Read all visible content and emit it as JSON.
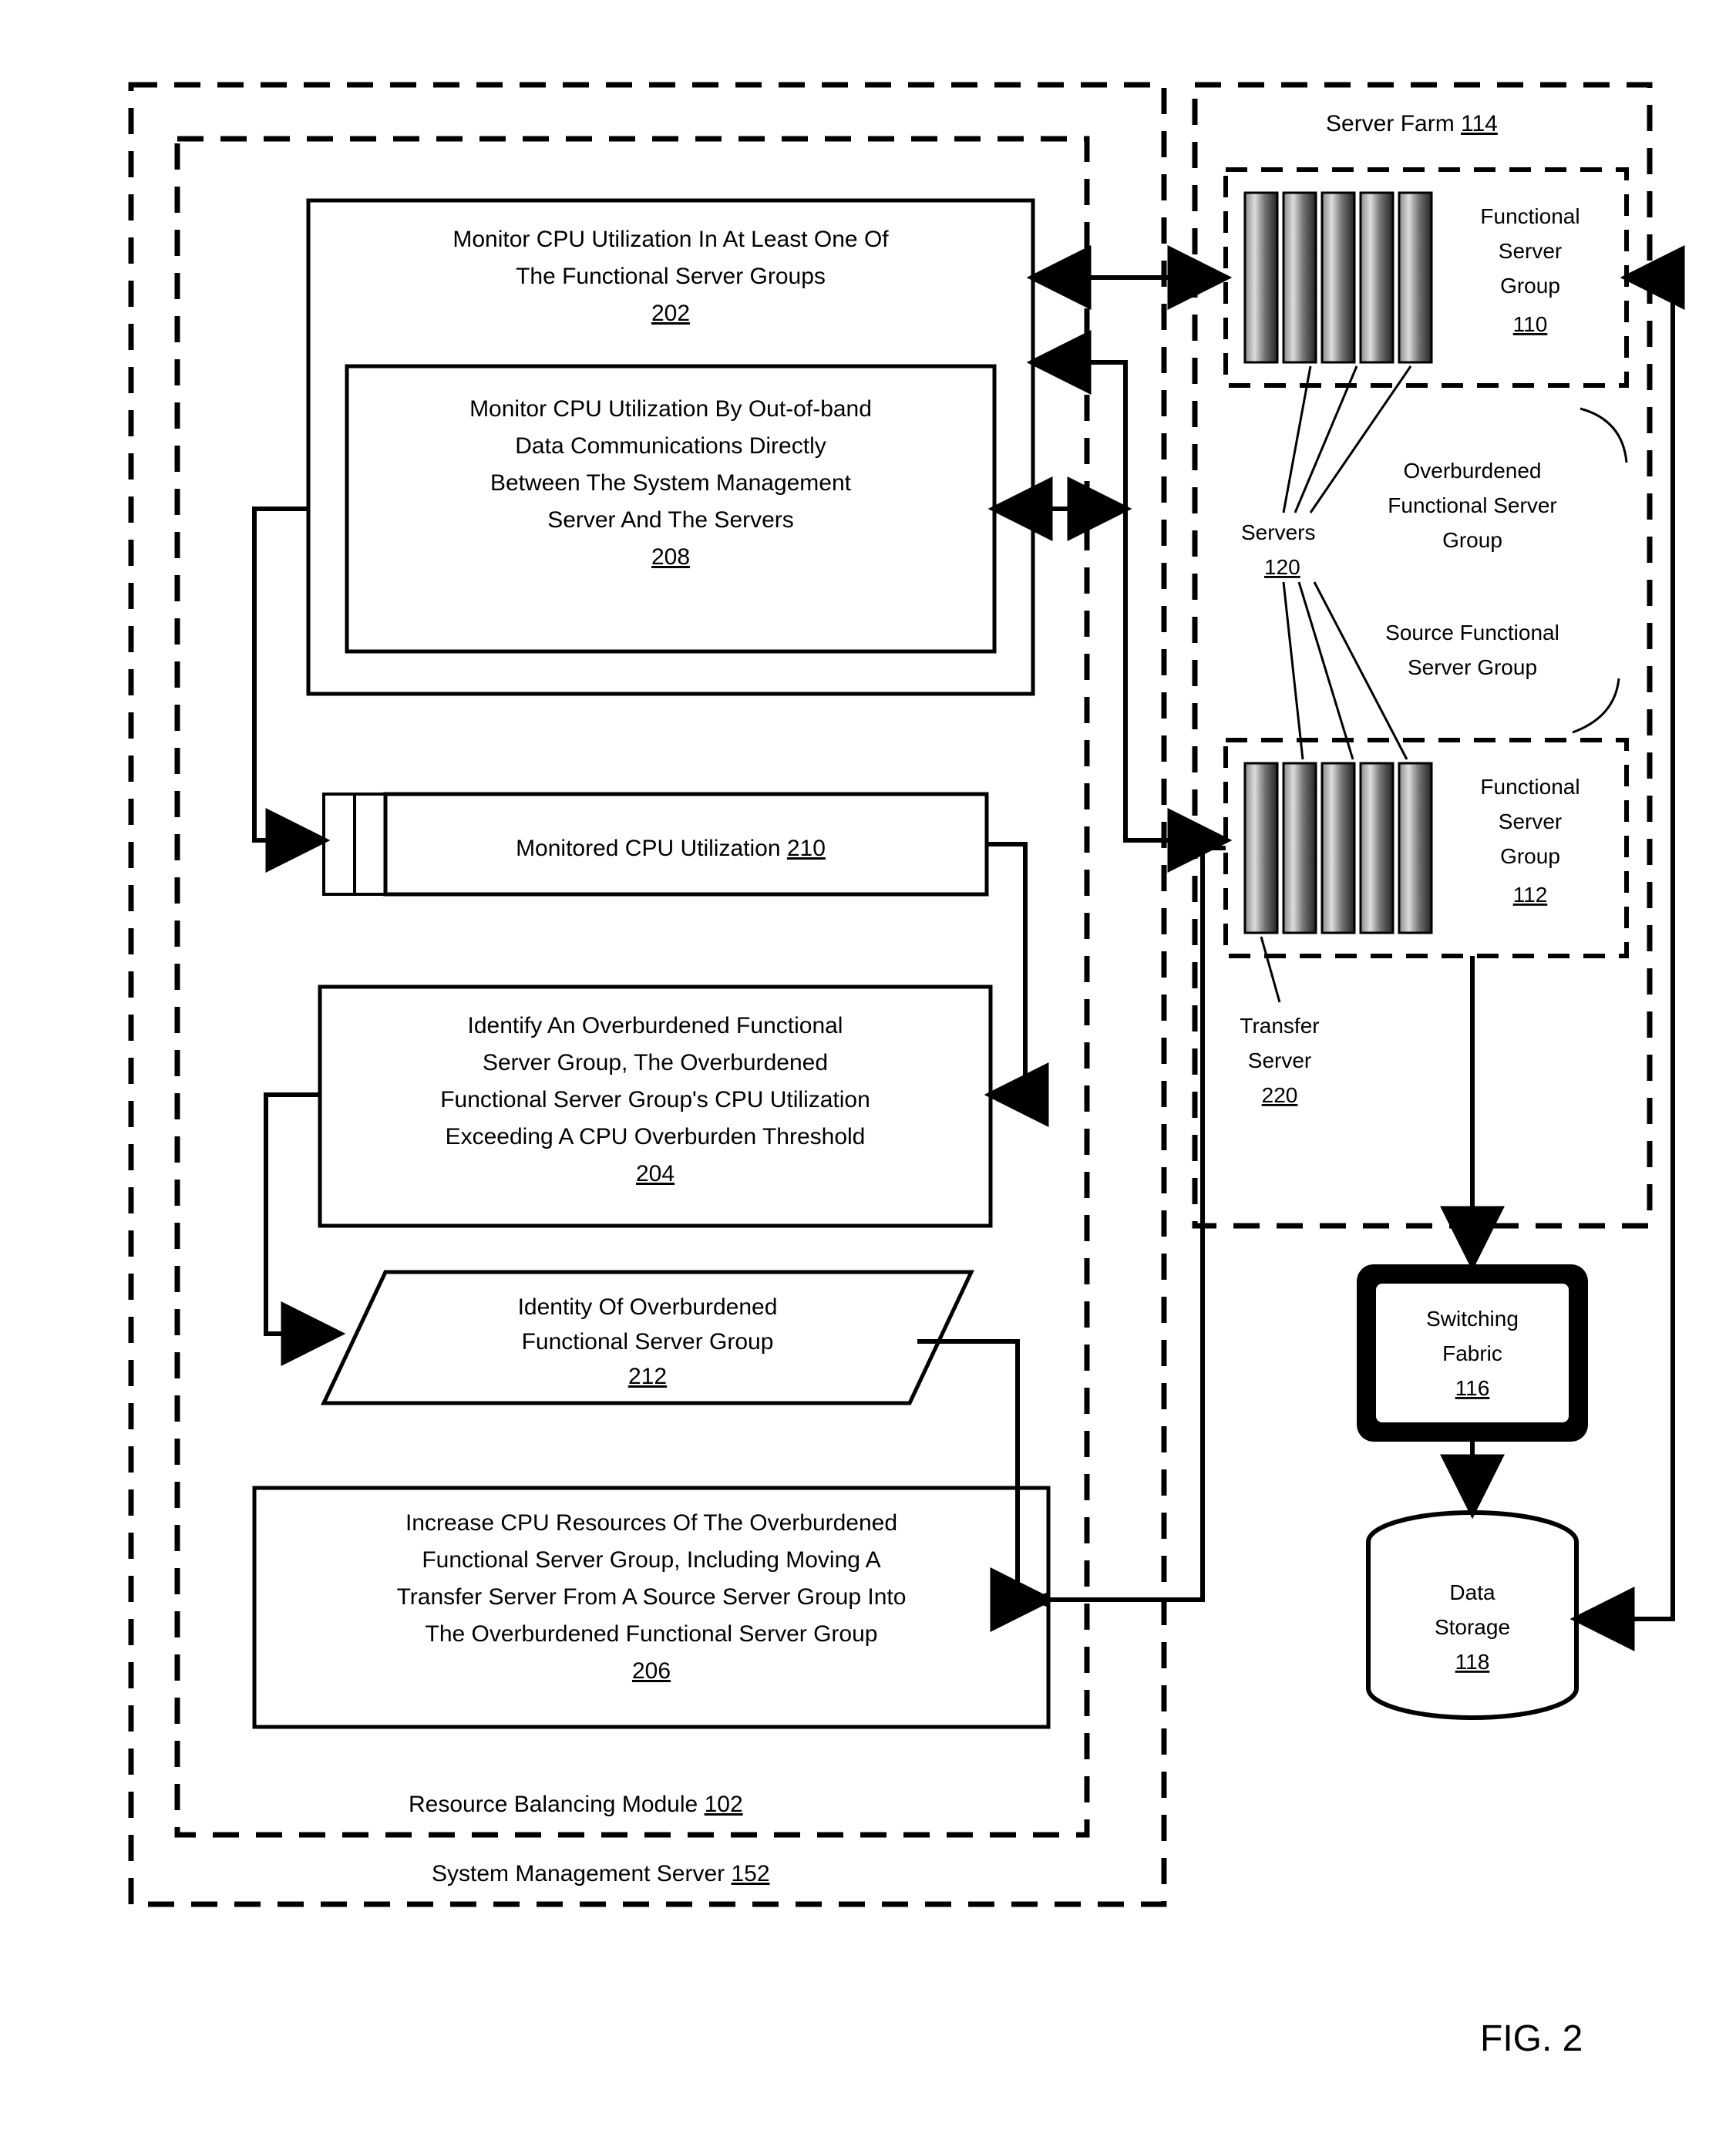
{
  "figure_label": "FIG. 2",
  "system_management_server": {
    "label": "System Management Server",
    "ref": "152"
  },
  "resource_balancing_module": {
    "label": "Resource Balancing Module",
    "ref": "102"
  },
  "server_farm": {
    "label": "Server Farm",
    "ref": "114"
  },
  "steps": {
    "monitor": {
      "l1": "Monitor CPU Utilization In At Least One Of",
      "l2": "The Functional Server Groups",
      "ref": "202"
    },
    "monitor_oob": {
      "l1": "Monitor CPU Utilization By Out-of-band",
      "l2": "Data Communications Directly",
      "l3": "Between The System Management",
      "l4": "Server And The Servers",
      "ref": "208"
    },
    "monitored_util": {
      "label": "Monitored CPU Utilization",
      "ref": "210"
    },
    "identify": {
      "l1": "Identify An Overburdened Functional",
      "l2": "Server Group, The Overburdened",
      "l3": "Functional Server Group's CPU Utilization",
      "l4": "Exceeding A CPU Overburden Threshold",
      "ref": "204"
    },
    "identity": {
      "l1": "Identity Of Overburdened",
      "l2": "Functional Server Group",
      "ref": "212"
    },
    "increase": {
      "l1": "Increase CPU Resources Of The Overburdened",
      "l2": "Functional Server Group, Including Moving A",
      "l3": "Transfer Server From A Source Server Group Into",
      "l4": "The Overburdened Functional Server Group",
      "ref": "206"
    }
  },
  "fsg110": {
    "l1": "Functional",
    "l2": "Server",
    "l3": "Group",
    "ref": "110"
  },
  "fsg112": {
    "l1": "Functional",
    "l2": "Server",
    "l3": "Group",
    "ref": "112"
  },
  "overburdened_label": {
    "l1": "Overburdened",
    "l2": "Functional Server",
    "l3": "Group"
  },
  "source_label": {
    "l1": "Source Functional",
    "l2": "Server Group"
  },
  "servers": {
    "label": "Servers",
    "ref": "120"
  },
  "transfer_server": {
    "l1": "Transfer",
    "l2": "Server",
    "ref": "220"
  },
  "switching_fabric": {
    "l1": "Switching",
    "l2": "Fabric",
    "ref": "116"
  },
  "data_storage": {
    "l1": "Data",
    "l2": "Storage",
    "ref": "118"
  }
}
